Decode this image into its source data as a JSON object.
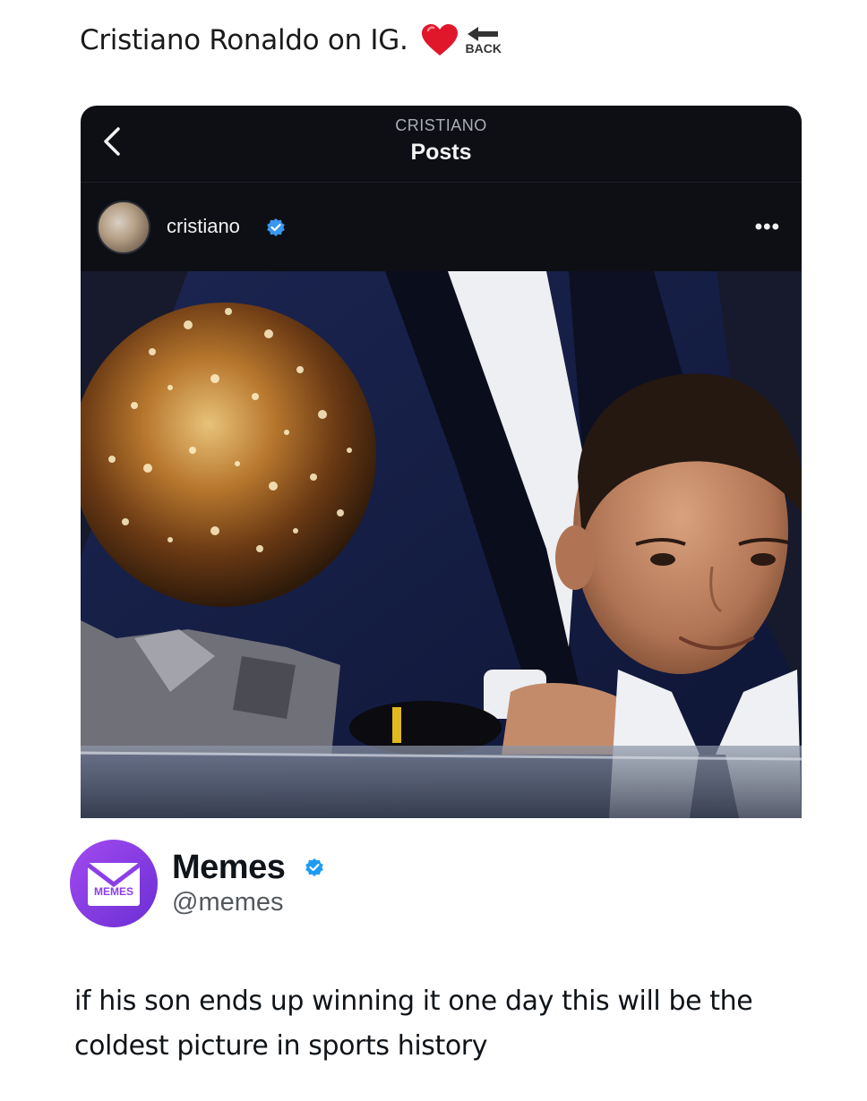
{
  "caption": {
    "text": "Cristiano Ronaldo on IG.",
    "heart_icon": "heart-icon",
    "back_label": "BACK"
  },
  "instagram": {
    "header_username": "CRISTIANO",
    "header_title": "Posts",
    "post_username": "cristiano",
    "more_label": "•••",
    "verified_color": "#3897f0"
  },
  "tweet": {
    "display_name": "Memes",
    "handle": "@memes",
    "avatar_label": "MEMES",
    "avatar_color": "#8b3fe8",
    "text": "if his son ends up winning it one day this will be the coldest picture in sports history"
  }
}
